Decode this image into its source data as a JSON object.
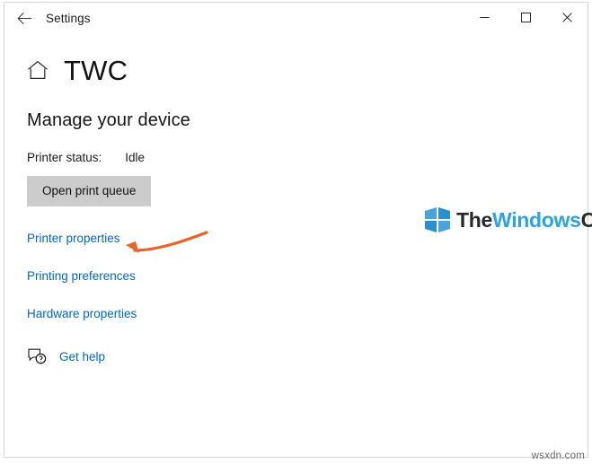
{
  "window": {
    "title": "Settings",
    "back_icon": "back-arrow-icon",
    "minimize_label": "Minimize",
    "maximize_label": "Maximize",
    "close_label": "Close"
  },
  "header": {
    "home_icon": "home-icon",
    "device_name": "TWC"
  },
  "main": {
    "section_title": "Manage your device",
    "printer_status_label": "Printer status:",
    "printer_status_value": "Idle",
    "open_print_queue": "Open print queue",
    "links": [
      {
        "label": "Printer properties",
        "name": "printer-properties-link"
      },
      {
        "label": "Printing preferences",
        "name": "printing-preferences-link"
      },
      {
        "label": "Hardware properties",
        "name": "hardware-properties-link"
      }
    ],
    "get_help": "Get help",
    "get_help_icon": "help-feedback-icon"
  },
  "annotation": {
    "arrow_color": "#e8642a",
    "points_to": "Printer properties"
  },
  "watermark": {
    "logo_the": "The",
    "logo_windows": "Windows",
    "logo_club": "Club",
    "logo_accent_color": "#2ea2df",
    "site": "wsxdn.com"
  },
  "colors": {
    "link": "#0066cc",
    "button_bg": "#cccccc",
    "accent_orange": "#e8642a"
  }
}
